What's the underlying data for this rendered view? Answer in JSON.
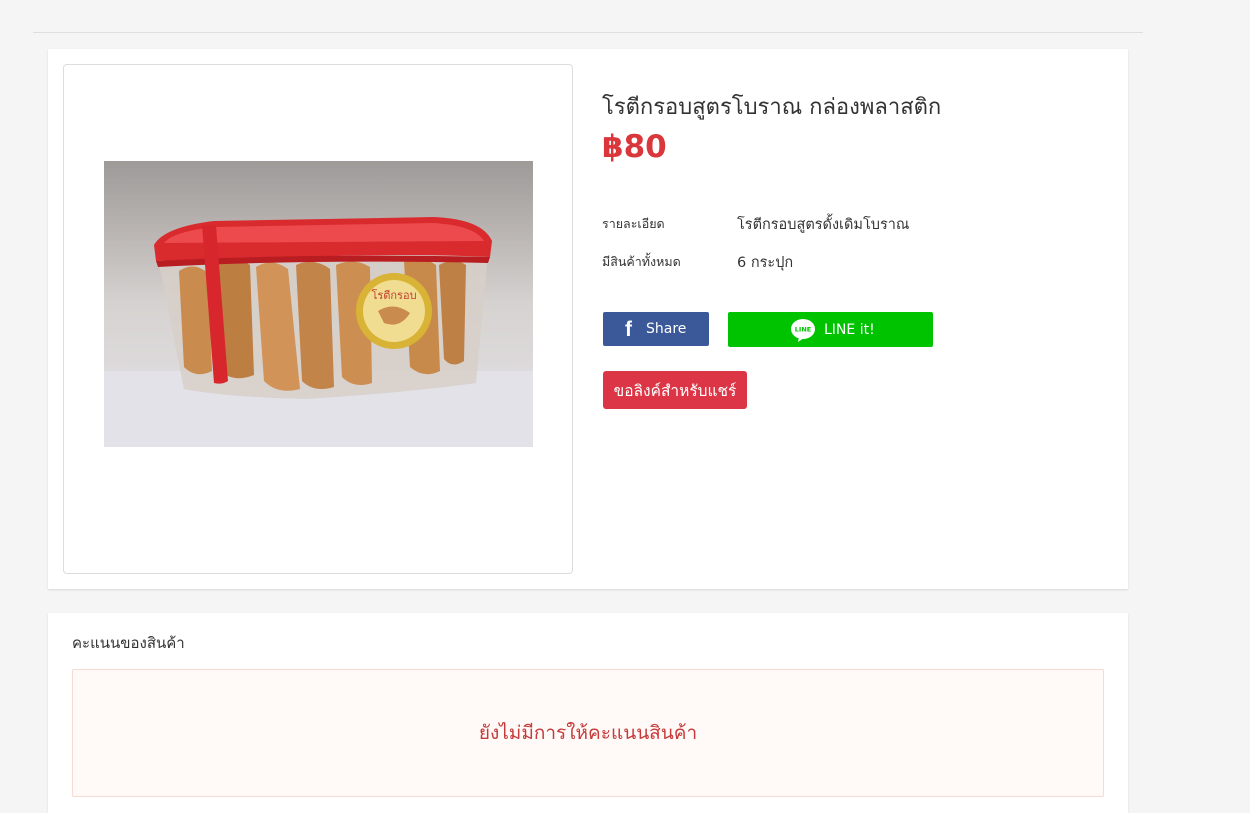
{
  "product": {
    "title": "โรตีกรอบสูตรโบราณ กล่องพลาสติก",
    "price": "฿80",
    "specs": [
      {
        "label": "รายละเอียด",
        "value": "โรตีกรอบสูตรดั้งเดิมโบราณ"
      },
      {
        "label": "มีสินค้าทั้งหมด",
        "value": "6 กระปุก"
      }
    ],
    "image_icon": "product-photo"
  },
  "share": {
    "facebook_label": "Share",
    "facebook_icon": "facebook-icon",
    "facebook_color": "#3b5998",
    "line_label": "LINE it!",
    "line_icon": "line-icon",
    "line_icon_text": "LINE",
    "line_color": "#00c300",
    "share_link_label": "ขอลิงค์สำหรับแชร์",
    "share_link_color": "#dc3545"
  },
  "rating": {
    "title": "คะแนนของสินค้า",
    "empty_text": "ยังไม่มีการให้คะแนนสินค้า"
  },
  "colors": {
    "price": "#d9373b",
    "page_background": "#f5f5f5"
  }
}
